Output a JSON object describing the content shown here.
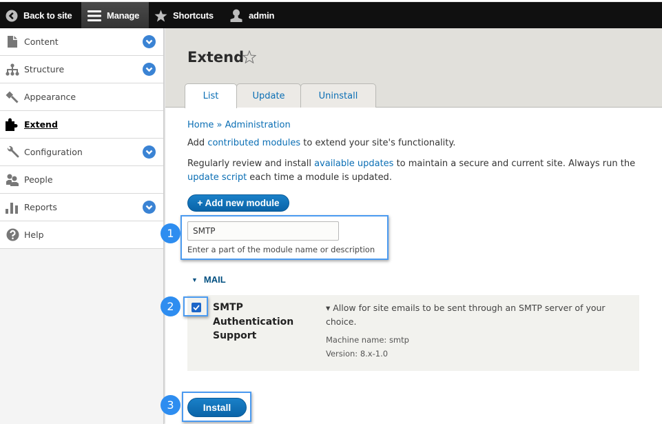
{
  "toolbar": {
    "back_to_site": "Back to site",
    "manage": "Manage",
    "shortcuts": "Shortcuts",
    "user": "admin"
  },
  "sidebar": {
    "items": [
      {
        "label": "Content",
        "icon": "file-icon",
        "expandable": true,
        "active": false
      },
      {
        "label": "Structure",
        "icon": "sitemap-icon",
        "expandable": true,
        "active": false
      },
      {
        "label": "Appearance",
        "icon": "paintbrush-icon",
        "expandable": false,
        "active": false
      },
      {
        "label": "Extend",
        "icon": "puzzle-icon",
        "expandable": false,
        "active": true
      },
      {
        "label": "Configuration",
        "icon": "wrench-icon",
        "expandable": true,
        "active": false
      },
      {
        "label": "People",
        "icon": "people-icon",
        "expandable": false,
        "active": false
      },
      {
        "label": "Reports",
        "icon": "bar-chart-icon",
        "expandable": true,
        "active": false
      },
      {
        "label": "Help",
        "icon": "question-icon",
        "expandable": false,
        "active": false
      }
    ]
  },
  "header": {
    "title": "Extend",
    "tabs": [
      {
        "label": "List",
        "active": true
      },
      {
        "label": "Update",
        "active": false
      },
      {
        "label": "Uninstall",
        "active": false
      }
    ]
  },
  "breadcrumb": {
    "home": "Home",
    "separator": " » ",
    "administration": "Administration"
  },
  "intro": {
    "p1_before": "Add ",
    "p1_link": "contributed modules",
    "p1_after": " to extend your site's functionality.",
    "p2_before": "Regularly review and install ",
    "p2_link1": "available updates",
    "p2_middle": " to maintain a secure and current site. Always run the",
    "p2_link2": "update script",
    "p2_after": " each time a module is updated."
  },
  "add_module_button": "+ Add new module",
  "filter": {
    "value": "SMTP",
    "description": "Enter a part of the module name or description"
  },
  "group": {
    "label": "MAIL"
  },
  "module": {
    "checked": true,
    "name": "SMTP Authentication Support",
    "description": "▾ Allow for site emails to be sent through an SMTP server of your choice.",
    "machine_name": "Machine name: smtp",
    "version": "Version: 8.x-1.0"
  },
  "install_button": "Install",
  "steps": [
    "1",
    "2",
    "3"
  ],
  "colors": {
    "link": "#0a6eb4",
    "button": "#0a64a8",
    "highlight": "#4a9af0",
    "step_badge": "#2e8df0",
    "toolbar_bg": "#101010"
  }
}
